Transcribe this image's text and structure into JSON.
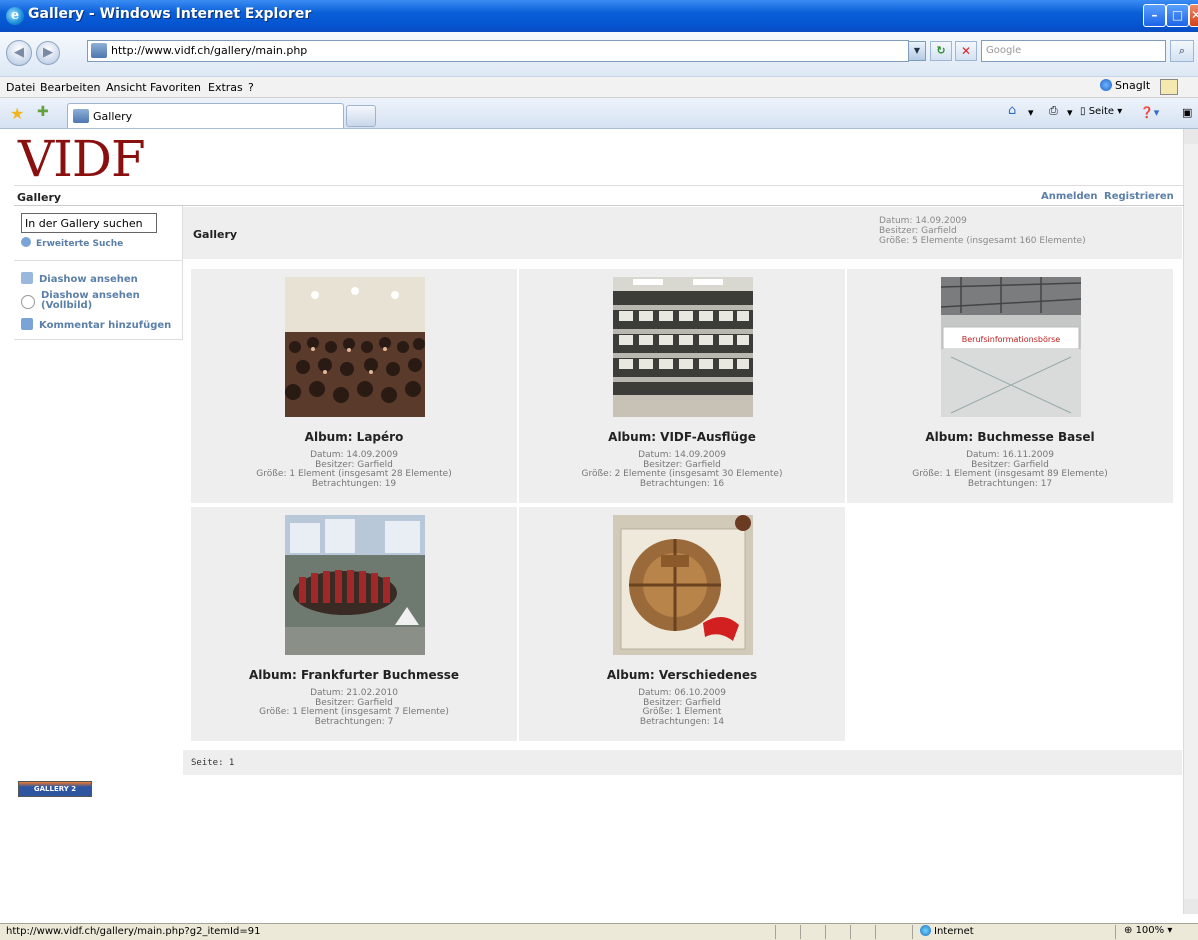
{
  "window": {
    "title": "Gallery - Windows Internet Explorer",
    "minimize": "–",
    "maximize": "□",
    "close": "✕"
  },
  "address_bar": {
    "url": "http://www.vidf.ch/gallery/main.php",
    "search_placeholder": "Google"
  },
  "menu": {
    "items": [
      "Datei",
      "Bearbeiten",
      "Ansicht",
      "Favoriten",
      "Extras",
      "?"
    ],
    "snagit": "SnagIt"
  },
  "tabs": {
    "active": "Gallery",
    "toolbar_page": "Seite"
  },
  "site": {
    "logo": "VIDF",
    "breadcrumb": "Gallery",
    "login": "Anmelden",
    "register": "Registrieren"
  },
  "sidebar": {
    "search_value": "In der Gallery suchen",
    "advanced_search": "Erweiterte Suche",
    "links": [
      "Diashow ansehen",
      "Diashow ansehen (Vollbild)",
      "Kommentar hinzufügen"
    ]
  },
  "gallery": {
    "title": "Gallery",
    "date": "Datum: 14.09.2009",
    "owner": "Besitzer: Garfield",
    "size": "Größe: 5 Elemente (insgesamt 160 Elemente)"
  },
  "albums": [
    {
      "title": "Album: Lapéro",
      "date": "Datum: 14.09.2009",
      "owner": "Besitzer: Garfield",
      "size": "Größe: 1 Element (insgesamt 28 Elemente)",
      "views": "Betrachtungen: 19"
    },
    {
      "title": "Album: VIDF-Ausflüge",
      "date": "Datum: 14.09.2009",
      "owner": "Besitzer: Garfield",
      "size": "Größe: 2 Elemente (insgesamt 30 Elemente)",
      "views": "Betrachtungen: 16"
    },
    {
      "title": "Album: Buchmesse Basel",
      "date": "Datum: 16.11.2009",
      "owner": "Besitzer: Garfield",
      "size": "Größe: 1 Element (insgesamt 89 Elemente)",
      "views": "Betrachtungen: 17",
      "thumb_sign": "Berufsinformationsbörse"
    },
    {
      "title": "Album: Frankfurter Buchmesse",
      "date": "Datum: 21.02.2010",
      "owner": "Besitzer: Garfield",
      "size": "Größe: 1 Element (insgesamt 7 Elemente)",
      "views": "Betrachtungen: 7"
    },
    {
      "title": "Album: Verschiedenes",
      "date": "Datum: 06.10.2009",
      "owner": "Besitzer: Garfield",
      "size": "Größe: 1 Element",
      "views": "Betrachtungen: 14"
    }
  ],
  "pager": "Seite: 1",
  "badge": "GALLERY 2",
  "status": {
    "url": "http://www.vidf.ch/gallery/main.php?g2_itemId=91",
    "zone": "Internet",
    "zoom": "100%"
  }
}
